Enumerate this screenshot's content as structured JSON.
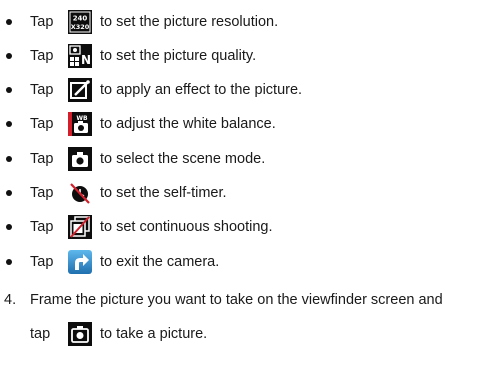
{
  "bullets": [
    {
      "tap": "Tap",
      "icon": "resolution-icon",
      "icon_text_top": "240",
      "icon_text_bottom": "X320",
      "text": "to set the picture resolution."
    },
    {
      "tap": "Tap",
      "icon": "quality-icon",
      "icon_text": "N",
      "text": "to set the picture quality."
    },
    {
      "tap": "Tap",
      "icon": "effect-icon",
      "text": "to apply an effect to the picture."
    },
    {
      "tap": "Tap",
      "icon": "white-balance-icon",
      "icon_text": "WB",
      "text": "to adjust the white balance."
    },
    {
      "tap": "Tap",
      "icon": "scene-mode-icon",
      "text": "to select the scene mode."
    },
    {
      "tap": "Tap",
      "icon": "self-timer-icon",
      "text": "to set the self-timer."
    },
    {
      "tap": "Tap",
      "icon": "continuous-shooting-icon",
      "text": "to set continuous shooting."
    },
    {
      "tap": "Tap",
      "icon": "exit-camera-icon",
      "text": "to exit the camera."
    }
  ],
  "step": {
    "number": "4.",
    "line1": "Frame the picture you want to take on the viewfinder screen and",
    "tap": "tap",
    "icon": "shutter-icon",
    "line2": "to take a picture."
  },
  "colors": {
    "icon_background": "#0d0d0d",
    "icon_foreground": "#ffffff",
    "wb_accent": "#d21f2b",
    "exit_accent": "#2a8fd0"
  }
}
